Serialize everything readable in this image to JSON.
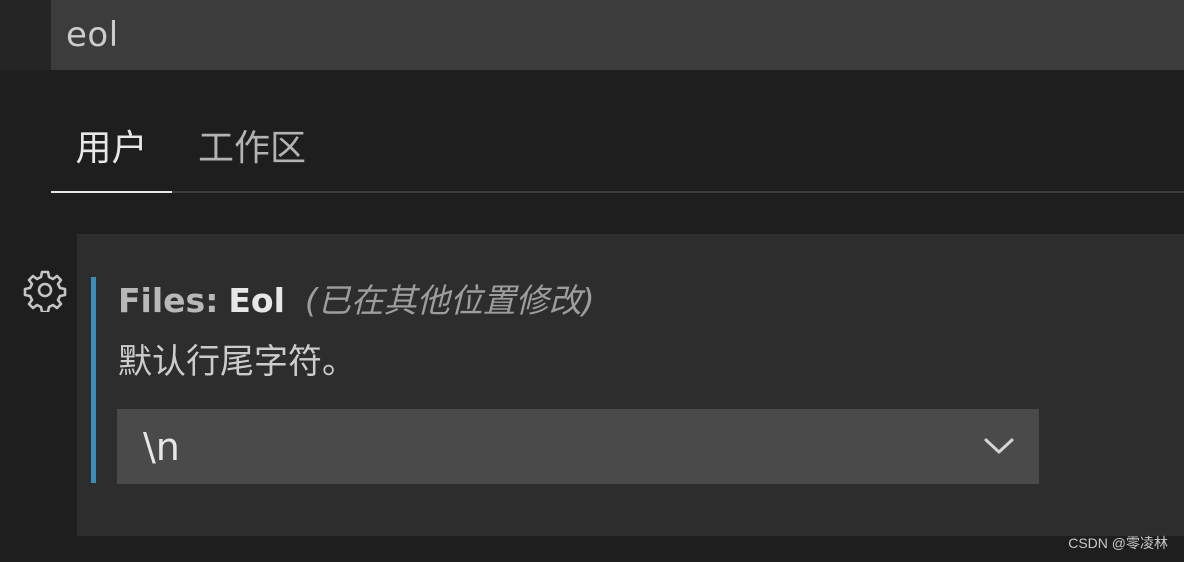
{
  "search": {
    "value": "eol"
  },
  "tabs": [
    {
      "label": "用户",
      "active": true
    },
    {
      "label": "工作区",
      "active": false
    }
  ],
  "setting": {
    "category": "Files:",
    "label": "Eol",
    "modified_note": "(已在其他位置修改)",
    "description": "默认行尾字符。",
    "selected_value": "\\n"
  },
  "icons": {
    "gear": "gear-icon",
    "chevron": "chevron-down-icon"
  },
  "watermark": "CSDN @零凌林",
  "colors": {
    "focus_bar": "#3b8eb8",
    "background": "#1e1e1e",
    "card": "#2d2d2d"
  }
}
